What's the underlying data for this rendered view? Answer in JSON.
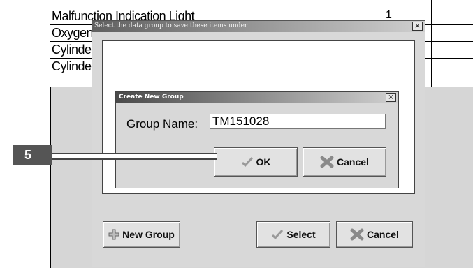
{
  "background_table": {
    "rows": [
      {
        "label": "Malfunction Indication Light",
        "value": "1"
      },
      {
        "label": "Oxygen Sensor",
        "value": ""
      },
      {
        "label": "Cylinder",
        "value": ""
      },
      {
        "label": "Cylinder",
        "value": ""
      }
    ]
  },
  "outer_dialog": {
    "title": "Select the data group to save these items under",
    "close": "×",
    "new_group_label": "New Group",
    "select_label": "Select",
    "cancel_label": "Cancel"
  },
  "inner_dialog": {
    "title": "Create New Group",
    "close": "×",
    "group_name_label": "Group Name:",
    "group_name_value": "TM151028",
    "ok_label": "OK",
    "cancel_label": "Cancel"
  },
  "callout": {
    "number": "5"
  }
}
